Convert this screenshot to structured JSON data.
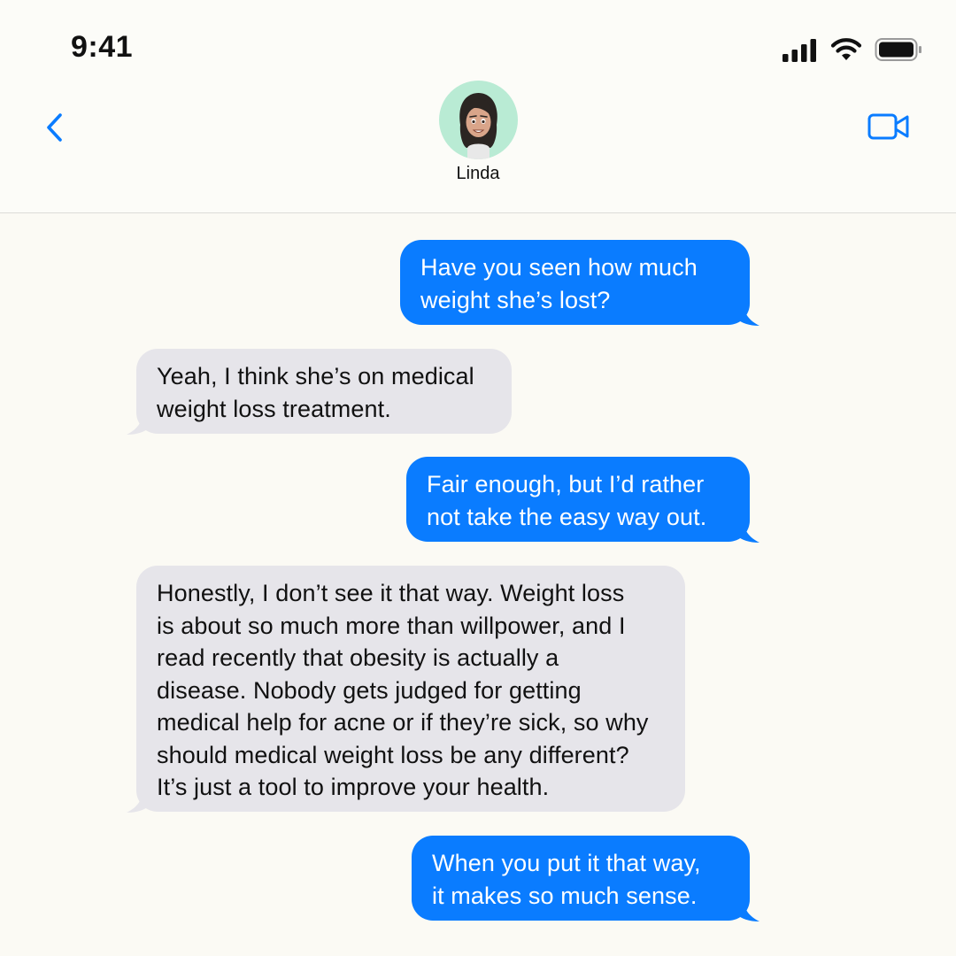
{
  "status_bar": {
    "time": "9:41"
  },
  "header": {
    "contact_name": "Linda",
    "icons": {
      "back": "chevron-left-icon",
      "video": "video-camera-icon",
      "avatar": "memoji-avatar"
    }
  },
  "colors": {
    "sent_bubble": "#0a7cff",
    "received_bubble": "#e6e5ea",
    "background": "#fbfaf4",
    "accent": "#0a7cff",
    "avatar_bg": "#b9ebd4"
  },
  "messages": [
    {
      "direction": "sent",
      "lines": [
        "Have you seen how much",
        "weight she’s lost?"
      ]
    },
    {
      "direction": "received",
      "lines": [
        "Yeah, I think she’s on medical",
        "weight loss treatment."
      ]
    },
    {
      "direction": "sent",
      "lines": [
        "Fair enough, but I’d rather",
        "not take the easy way out."
      ]
    },
    {
      "direction": "received",
      "lines": [
        "Honestly, I don’t see it that way. Weight loss",
        "is about so much more than willpower, and I",
        "read recently that obesity is actually a",
        "disease. Nobody gets judged for getting",
        "medical help for acne or if they’re sick, so why",
        "should medical weight loss be any different?",
        "It’s just a tool to improve your health."
      ]
    },
    {
      "direction": "sent",
      "lines": [
        "When you put it that way,",
        "it makes so much sense."
      ]
    }
  ]
}
